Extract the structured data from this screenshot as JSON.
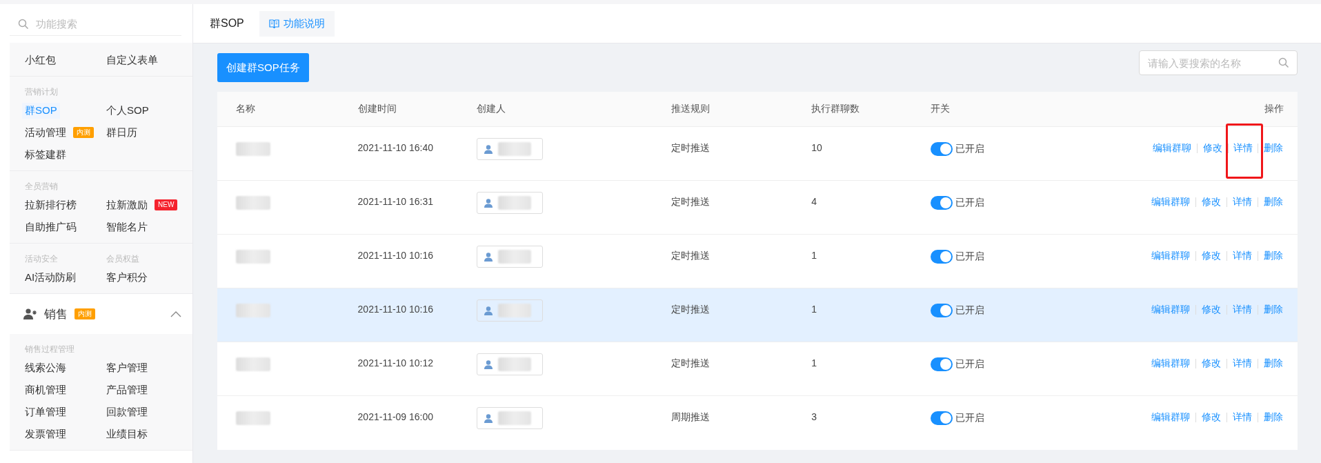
{
  "sidebar": {
    "search": {
      "placeholder": "功能搜索"
    },
    "sections": [
      {
        "items": [
          {
            "text": "小红包",
            "selected": false
          },
          {
            "text": "自定义表单",
            "selected": false
          }
        ]
      },
      {
        "labels": [
          "营销计划"
        ],
        "items": [
          {
            "text": "群SOP",
            "selected": true
          },
          {
            "text": "个人SOP",
            "selected": false
          },
          {
            "text": "活动管理",
            "selected": false,
            "badge": {
              "text": "内测",
              "kind": "beta"
            }
          },
          {
            "text": "群日历",
            "selected": false
          },
          {
            "text": "标签建群",
            "selected": false
          }
        ]
      },
      {
        "labels": [
          "全员营销"
        ],
        "items": [
          {
            "text": "拉新排行榜",
            "selected": false
          },
          {
            "text": "拉新激励",
            "selected": false,
            "badge": {
              "text": "NEW",
              "kind": "new"
            }
          },
          {
            "text": "自助推广码",
            "selected": false
          },
          {
            "text": "智能名片",
            "selected": false
          }
        ]
      },
      {
        "labels": [
          "活动安全",
          "会员权益"
        ],
        "items": [
          {
            "text": "AI活动防刷",
            "selected": false
          },
          {
            "text": "客户积分",
            "selected": false
          }
        ]
      }
    ],
    "category": {
      "text": "销售",
      "expanded": true,
      "badge": {
        "text": "内测",
        "kind": "beta"
      }
    },
    "category_sections": [
      {
        "labels": [
          "销售过程管理"
        ],
        "items": [
          {
            "text": "线索公海",
            "selected": false
          },
          {
            "text": "客户管理",
            "selected": false
          },
          {
            "text": "商机管理",
            "selected": false
          },
          {
            "text": "产品管理",
            "selected": false
          },
          {
            "text": "订单管理",
            "selected": false
          },
          {
            "text": "回款管理",
            "selected": false
          },
          {
            "text": "发票管理",
            "selected": false
          },
          {
            "text": "业绩目标",
            "selected": false
          }
        ]
      }
    ]
  },
  "header": {
    "title": "群SOP",
    "help_link": "功能说明"
  },
  "toolbar": {
    "create_button": "创建群SOP任务",
    "search": {
      "placeholder": "请输入要搜索的名称"
    }
  },
  "table": {
    "columns": [
      "名称",
      "创建时间",
      "创建人",
      "推送规则",
      "执行群聊数",
      "开关",
      "操作"
    ],
    "rows": [
      {
        "created": "2021-11-10 16:40",
        "rule": "定时推送",
        "groups": "10",
        "on": true,
        "switch_label": "已开启",
        "hovered": false,
        "actions": [
          {
            "text": "编辑群聊",
            "highlighted": false
          },
          {
            "text": "修改",
            "highlighted": false
          },
          {
            "text": "详情",
            "highlighted": true
          },
          {
            "text": "删除",
            "highlighted": false
          }
        ]
      },
      {
        "created": "2021-11-10 16:31",
        "rule": "定时推送",
        "groups": "4",
        "on": true,
        "switch_label": "已开启",
        "hovered": false,
        "actions": [
          {
            "text": "编辑群聊",
            "highlighted": false
          },
          {
            "text": "修改",
            "highlighted": false
          },
          {
            "text": "详情",
            "highlighted": false
          },
          {
            "text": "删除",
            "highlighted": false
          }
        ]
      },
      {
        "created": "2021-11-10 10:16",
        "rule": "定时推送",
        "groups": "1",
        "on": true,
        "switch_label": "已开启",
        "hovered": false,
        "actions": [
          {
            "text": "编辑群聊",
            "highlighted": false
          },
          {
            "text": "修改",
            "highlighted": false
          },
          {
            "text": "详情",
            "highlighted": false
          },
          {
            "text": "删除",
            "highlighted": false
          }
        ]
      },
      {
        "created": "2021-11-10 10:16",
        "rule": "定时推送",
        "groups": "1",
        "on": true,
        "switch_label": "已开启",
        "hovered": true,
        "actions": [
          {
            "text": "编辑群聊",
            "highlighted": false
          },
          {
            "text": "修改",
            "highlighted": false
          },
          {
            "text": "详情",
            "highlighted": false
          },
          {
            "text": "删除",
            "highlighted": false
          }
        ]
      },
      {
        "created": "2021-11-10 10:12",
        "rule": "定时推送",
        "groups": "1",
        "on": true,
        "switch_label": "已开启",
        "hovered": false,
        "actions": [
          {
            "text": "编辑群聊",
            "highlighted": false
          },
          {
            "text": "修改",
            "highlighted": false
          },
          {
            "text": "详情",
            "highlighted": false
          },
          {
            "text": "删除",
            "highlighted": false
          }
        ]
      },
      {
        "created": "2021-11-09 16:00",
        "rule": "周期推送",
        "groups": "3",
        "on": true,
        "switch_label": "已开启",
        "hovered": false,
        "actions": [
          {
            "text": "编辑群聊",
            "highlighted": false
          },
          {
            "text": "修改",
            "highlighted": false
          },
          {
            "text": "详情",
            "highlighted": false
          },
          {
            "text": "删除",
            "highlighted": false
          }
        ]
      }
    ]
  }
}
